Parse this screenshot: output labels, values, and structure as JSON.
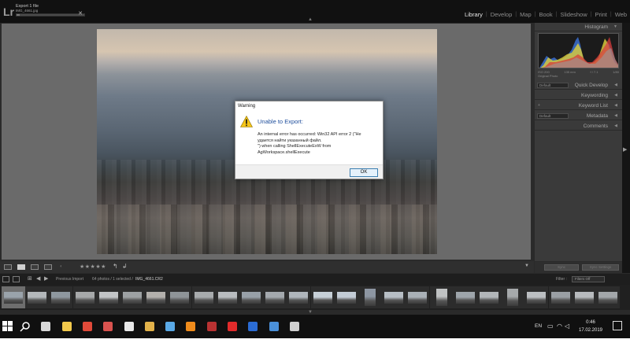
{
  "app": {
    "logo": "Lr",
    "export_status": "Export 1 file",
    "export_file": "IMG_4661.jpg",
    "export_progress": 0.05
  },
  "modules": [
    {
      "label": "Library",
      "active": true
    },
    {
      "label": "Develop",
      "active": false
    },
    {
      "label": "Map",
      "active": false
    },
    {
      "label": "Book",
      "active": false
    },
    {
      "label": "Slideshow",
      "active": false
    },
    {
      "label": "Print",
      "active": false
    },
    {
      "label": "Web",
      "active": false
    }
  ],
  "dialog": {
    "title": "Warning",
    "heading": "Unable to Export:",
    "message_lines": [
      "An internal error has occurred: Win32 API error 2 (\"Не",
      "удается найти указанный файл.",
      "\") when calling ShellExecuteExW from",
      "AgWorkspace.shellExecute"
    ],
    "ok_label": "OK"
  },
  "right_panel": {
    "histogram_label": "Histogram",
    "hist_stats": [
      "ISO 200",
      "135 mm",
      "f / 7.1",
      "1/80"
    ],
    "original_photo": "Original Photo",
    "panels": [
      {
        "label": "Quick Develop",
        "select": "Default"
      },
      {
        "label": "Keywording",
        "select": ""
      },
      {
        "label": "Keyword List",
        "select": ""
      },
      {
        "label": "Metadata",
        "select": "Default"
      },
      {
        "label": "Comments",
        "select": ""
      }
    ],
    "sync_label": "Sync",
    "sync_settings_label": "Sync Settings"
  },
  "toolbar": {
    "stars": "★★★★★"
  },
  "filmnav": {
    "source": "Previous Import",
    "count": "64 photos / 1 selected /",
    "filename": "IMG_4661.CR2",
    "filter_label": "Filter :",
    "filter_value": "Filters Off"
  },
  "filmstrip": {
    "selected_index": 0,
    "thumbs": [
      {
        "orientation": "landscape",
        "tone": "#9aa3ab"
      },
      {
        "orientation": "landscape",
        "tone": "#b4b8bb"
      },
      {
        "orientation": "landscape",
        "tone": "#8e979f"
      },
      {
        "orientation": "landscape",
        "tone": "#a7a9aa"
      },
      {
        "orientation": "landscape",
        "tone": "#c2c4c6"
      },
      {
        "orientation": "landscape",
        "tone": "#9da1a3"
      },
      {
        "orientation": "landscape",
        "tone": "#b3b0ac"
      },
      {
        "orientation": "landscape",
        "tone": "#8f9498"
      },
      {
        "orientation": "landscape",
        "tone": "#a8abad"
      },
      {
        "orientation": "landscape",
        "tone": "#b9bcbf"
      },
      {
        "orientation": "landscape",
        "tone": "#98a0a8"
      },
      {
        "orientation": "landscape",
        "tone": "#a4a9ae"
      },
      {
        "orientation": "landscape",
        "tone": "#b0b6bc"
      },
      {
        "orientation": "landscape",
        "tone": "#c7d0d8"
      },
      {
        "orientation": "landscape",
        "tone": "#c3ccd6"
      },
      {
        "orientation": "portrait",
        "tone": "#8d96a2"
      },
      {
        "orientation": "landscape",
        "tone": "#b7bec5"
      },
      {
        "orientation": "landscape",
        "tone": "#a9b0b6"
      },
      {
        "orientation": "portrait",
        "tone": "#c0c2c3"
      },
      {
        "orientation": "landscape",
        "tone": "#9ea5ab"
      },
      {
        "orientation": "landscape",
        "tone": "#b2b6b9"
      },
      {
        "orientation": "portrait",
        "tone": "#a6a9ab"
      },
      {
        "orientation": "landscape",
        "tone": "#bcbfc2"
      },
      {
        "orientation": "landscape",
        "tone": "#9a9fa4"
      },
      {
        "orientation": "landscape",
        "tone": "#b8bbbe"
      },
      {
        "orientation": "landscape",
        "tone": "#a3a7aa"
      }
    ]
  },
  "taskbar": {
    "apps": [
      {
        "name": "search-icon",
        "color": "#ffffff"
      },
      {
        "name": "calculator-icon",
        "color": "#d8d8d8"
      },
      {
        "name": "file-explorer-icon",
        "color": "#f2c94c"
      },
      {
        "name": "chrome-icon",
        "color": "#e04a3a"
      },
      {
        "name": "app-red-icon",
        "color": "#d9534f"
      },
      {
        "name": "app-paint-icon",
        "color": "#e8e8e8"
      },
      {
        "name": "app-tools-icon",
        "color": "#e2b24a"
      },
      {
        "name": "app-grid-icon",
        "color": "#5aa9e6"
      },
      {
        "name": "vlc-icon",
        "color": "#f08c1c"
      },
      {
        "name": "app-red-book-icon",
        "color": "#b93232"
      },
      {
        "name": "opera-icon",
        "color": "#e22b2b"
      },
      {
        "name": "photoshop-icon",
        "color": "#2b6cd4"
      },
      {
        "name": "lightroom-icon",
        "color": "#4a90d9"
      },
      {
        "name": "app-bird-icon",
        "color": "#cfcfcf"
      }
    ],
    "lang": "EN",
    "time": "0:46",
    "date": "17.02.2019"
  }
}
